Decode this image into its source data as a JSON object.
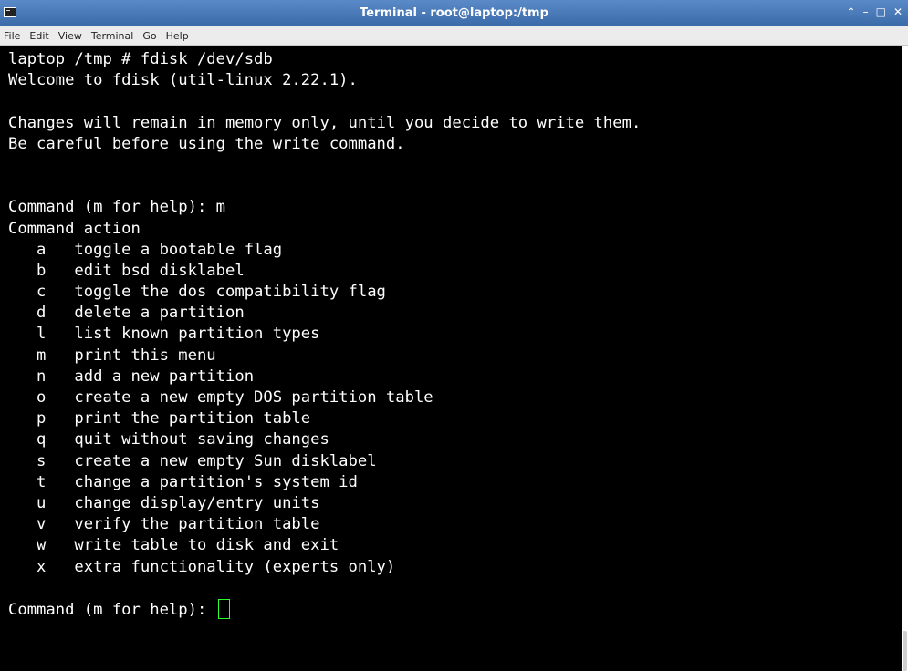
{
  "window": {
    "title": "Terminal - root@laptop:/tmp",
    "buttons": {
      "up": "↑",
      "minimize": "–",
      "maximize": "□",
      "close": "✕"
    }
  },
  "menubar": [
    "File",
    "Edit",
    "View",
    "Terminal",
    "Go",
    "Help"
  ],
  "terminal": {
    "lines": [
      "laptop /tmp # fdisk /dev/sdb",
      "Welcome to fdisk (util-linux 2.22.1).",
      "",
      "Changes will remain in memory only, until you decide to write them.",
      "Be careful before using the write command.",
      "",
      "",
      "Command (m for help): m",
      "Command action",
      "   a   toggle a bootable flag",
      "   b   edit bsd disklabel",
      "   c   toggle the dos compatibility flag",
      "   d   delete a partition",
      "   l   list known partition types",
      "   m   print this menu",
      "   n   add a new partition",
      "   o   create a new empty DOS partition table",
      "   p   print the partition table",
      "   q   quit without saving changes",
      "   s   create a new empty Sun disklabel",
      "   t   change a partition's system id",
      "   u   change display/entry units",
      "   v   verify the partition table",
      "   w   write table to disk and exit",
      "   x   extra functionality (experts only)",
      ""
    ],
    "prompt": "Command (m for help): ",
    "cursor_color": "#2bff2b"
  },
  "colors": {
    "titlebar": "#4a7ab8",
    "terminal_bg": "#000000",
    "terminal_fg": "#ffffff"
  },
  "icons": {
    "app": "terminal-app-icon"
  }
}
